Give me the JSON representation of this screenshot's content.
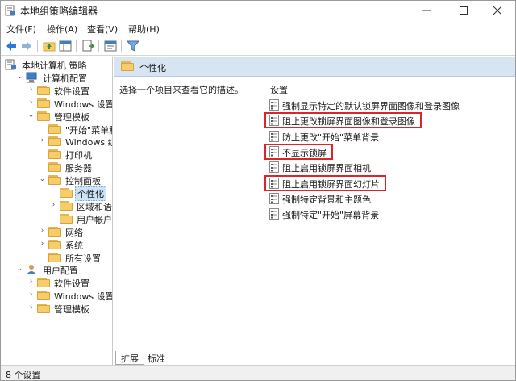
{
  "window": {
    "title": "本地组策略编辑器"
  },
  "menu": [
    "文件(F)",
    "操作(A)",
    "查看(V)",
    "帮助(H)"
  ],
  "tree": [
    {
      "label": "本地计算机 策略",
      "level": 0,
      "exp": "",
      "icon": "computer-policy-icon"
    },
    {
      "label": "计算机配置",
      "level": 1,
      "exp": "v",
      "icon": "computer-icon"
    },
    {
      "label": "软件设置",
      "level": 2,
      "exp": ">",
      "icon": "folder-icon"
    },
    {
      "label": "Windows 设置",
      "level": 2,
      "exp": ">",
      "icon": "folder-icon"
    },
    {
      "label": "管理模板",
      "level": 2,
      "exp": "v",
      "icon": "folder-icon"
    },
    {
      "label": "\"开始\"菜单和任",
      "level": 3,
      "exp": "",
      "icon": "folder-icon"
    },
    {
      "label": "Windows 组件",
      "level": 3,
      "exp": ">",
      "icon": "folder-icon"
    },
    {
      "label": "打印机",
      "level": 3,
      "exp": "",
      "icon": "folder-icon"
    },
    {
      "label": "服务器",
      "level": 3,
      "exp": "",
      "icon": "folder-icon"
    },
    {
      "label": "控制面板",
      "level": 3,
      "exp": "v",
      "icon": "folder-icon"
    },
    {
      "label": "个性化",
      "level": 4,
      "exp": "",
      "icon": "folder-icon",
      "selected": true
    },
    {
      "label": "区域和语言",
      "level": 4,
      "exp": ">",
      "icon": "folder-icon"
    },
    {
      "label": "用户帐户",
      "level": 4,
      "exp": "",
      "icon": "folder-icon"
    },
    {
      "label": "网络",
      "level": 3,
      "exp": ">",
      "icon": "folder-icon"
    },
    {
      "label": "系统",
      "level": 3,
      "exp": ">",
      "icon": "folder-icon"
    },
    {
      "label": "所有设置",
      "level": 3,
      "exp": "",
      "icon": "folder-icon"
    },
    {
      "label": "用户配置",
      "level": 1,
      "exp": "v",
      "icon": "user-icon"
    },
    {
      "label": "软件设置",
      "level": 2,
      "exp": ">",
      "icon": "folder-icon"
    },
    {
      "label": "Windows 设置",
      "level": 2,
      "exp": ">",
      "icon": "folder-icon"
    },
    {
      "label": "管理模板",
      "level": 2,
      "exp": ">",
      "icon": "folder-icon"
    }
  ],
  "right": {
    "header": "个性化",
    "description": "选择一个项目来查看它的描述。",
    "settings_header": "设置",
    "settings": [
      {
        "label": "强制显示特定的默认锁屏界面图像和登录图像",
        "highlighted": false
      },
      {
        "label": "阻止更改锁屏界面图像和登录图像",
        "highlighted": true
      },
      {
        "label": "防止更改\"开始\"菜单背景",
        "highlighted": false
      },
      {
        "label": "不显示锁屏",
        "highlighted": true
      },
      {
        "label": "阻止启用锁屏界面相机",
        "highlighted": false
      },
      {
        "label": "阻止启用锁屏界面幻灯片",
        "highlighted": true
      },
      {
        "label": "强制特定背景和主题色",
        "highlighted": false
      },
      {
        "label": "强制特定\"开始\"屏幕背景",
        "highlighted": false
      }
    ]
  },
  "tabs": [
    "扩展",
    "标准"
  ],
  "status": "8 个设置",
  "colors": {
    "highlight_box": "#d8262c",
    "header_bg": "#d7e4f2",
    "selected_bg": "#cce4f7"
  }
}
